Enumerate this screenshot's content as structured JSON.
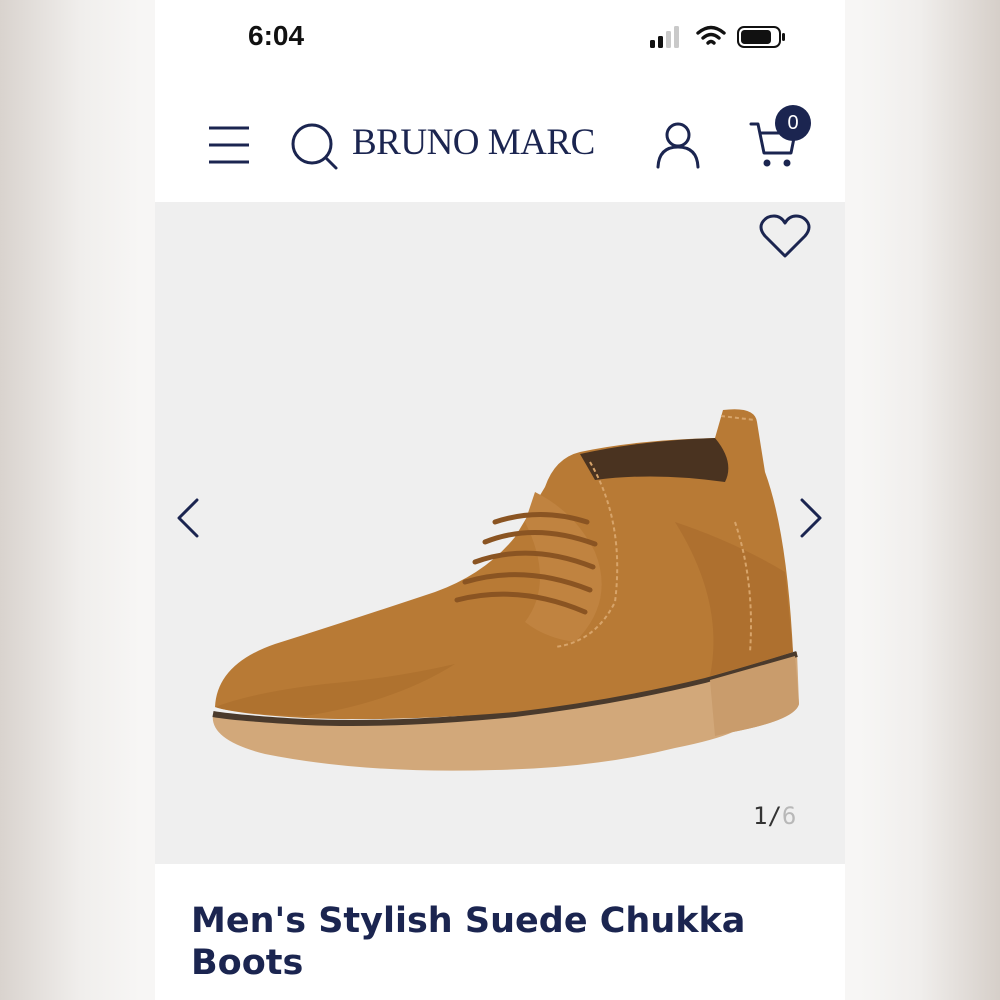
{
  "status_bar": {
    "time": "6:04",
    "icons": [
      "cellular-signal-icon",
      "wifi-icon",
      "battery-icon"
    ]
  },
  "header": {
    "menu_icon": "hamburger-menu-icon",
    "search_icon": "search-icon",
    "brand": "BRUNO MARC",
    "account_icon": "user-icon",
    "cart_icon": "cart-icon",
    "cart_count": "0"
  },
  "gallery": {
    "wishlist_icon": "heart-icon",
    "prev_icon": "chevron-left-icon",
    "next_icon": "chevron-right-icon",
    "current": "1",
    "separator": "/",
    "total": "6",
    "image": "suede-chukka-boot-photo"
  },
  "product": {
    "title": "Men's Stylish Suede Chukka Boots"
  },
  "colors": {
    "brand_navy": "#1b2550",
    "gallery_bg": "#efefef",
    "boot_tan": "#b87a35"
  }
}
